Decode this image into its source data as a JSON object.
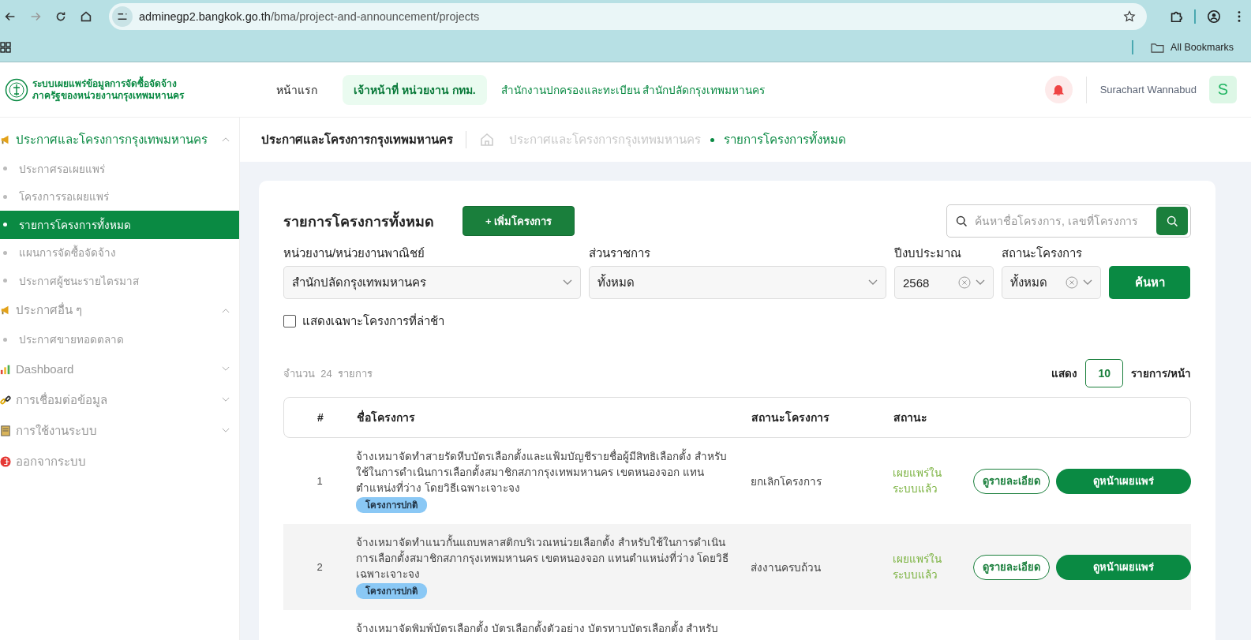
{
  "browser": {
    "url_host": "adminegp2.bangkok.go.th",
    "url_path": "/bma/project-and-announcement/projects",
    "bookmarks_label": "All Bookmarks"
  },
  "header": {
    "logo_lines": [
      "ระบบเผยแพร่ข้อมูลการจัดซื้อจัดจ้าง",
      "ภาครัฐของหน่วยงานกรุงเทพมหานคร"
    ],
    "nav": [
      {
        "label": "หน้าแรก",
        "selected": false
      },
      {
        "label": "เจ้าหน้าที่ หน่วยงาน กทม.",
        "selected": true
      }
    ],
    "agency": "สำนักงานปกครองและทะเบียน สำนักปลัดกรุงเทพมหานคร",
    "user_name": "Surachart Wannabud",
    "avatar_initial": "S"
  },
  "sidebar": {
    "groups": [
      {
        "label": "ประกาศและโครงการกรุงเทพมหานคร",
        "kind": "section",
        "active": true,
        "expanded": true,
        "items": [
          {
            "label": "ประกาศรอเผยแพร่",
            "selected": false
          },
          {
            "label": "โครงการรอเผยแพร่",
            "selected": false
          },
          {
            "label": "รายการโครงการทั้งหมด",
            "selected": true
          },
          {
            "label": "แผนการจัดซื้อจัดจ้าง",
            "selected": false
          },
          {
            "label": "ประกาศผู้ชนะรายไตรมาส",
            "selected": false
          }
        ]
      },
      {
        "label": "ประกาศอื่น ๆ",
        "kind": "section",
        "active": false,
        "expanded": true,
        "items": [
          {
            "label": "ประกาศขายทอดตลาด",
            "selected": false
          }
        ]
      },
      {
        "label": "Dashboard",
        "kind": "section",
        "active": false,
        "expanded": false
      },
      {
        "label": "การเชื่อมต่อข้อมูล",
        "kind": "section",
        "active": false,
        "expanded": false
      },
      {
        "label": "การใช้งานระบบ",
        "kind": "section",
        "active": false,
        "expanded": false
      },
      {
        "label": "ออกจากระบบ",
        "kind": "link",
        "active": false
      }
    ]
  },
  "breadcrumb": {
    "title": "ประกาศและโครงการกรุงเทพมหานคร",
    "crumbs": [
      {
        "label": "ประกาศและโครงการกรุงเทพมหานคร",
        "selected": false
      },
      {
        "label": "รายการโครงการทั้งหมด",
        "selected": true
      }
    ]
  },
  "panel": {
    "title": "รายการโครงการทั้งหมด",
    "add_button": "+ เพิ่มโครงการ",
    "search": {
      "placeholder": "ค้นหาชื่อโครงการ, เลขที่โครงการ"
    },
    "filters": [
      {
        "label": "หน่วยงาน/หน่วยงานพาณิชย์",
        "value": "สำนักปลัดกรุงเทพมหานคร",
        "clearable": false
      },
      {
        "label": "ส่วนราชการ",
        "value": "ทั้งหมด",
        "clearable": false
      },
      {
        "label": "ปีงบประมาณ",
        "value": "2568",
        "clearable": true
      },
      {
        "label": "สถานะโครงการ",
        "value": "ทั้งหมด",
        "clearable": true
      }
    ],
    "search_button": "ค้นหา",
    "late_only": {
      "label": "แสดงเฉพาะโครงการที่ล่าช้า",
      "checked": false
    },
    "count": {
      "prefix": "จำนวน",
      "number": "24",
      "suffix": "รายการ"
    },
    "page_size": {
      "prefix": "แสดง",
      "value": "10",
      "suffix": "รายการ/หน้า"
    }
  },
  "table": {
    "columns": [
      "#",
      "ชื่อโครงการ",
      "สถานะโครงการ",
      "สถานะ"
    ],
    "rows": [
      {
        "number": "1",
        "name": "จ้างเหมาจัดทำสายรัดหีบบัตรเลือกตั้งและแฟ้มบัญชีรายชื่อผู้มีสิทธิเลือกตั้ง สำหรับใช้ในการดำเนินการเลือกตั้งสมาชิกสภากรุงเทพมหานคร เขตหนองจอก แทนตำแหน่งที่ว่าง โดยวิธีเฉพาะเจาะจง",
        "tag": "โครงการปกติ",
        "project_status": "ยกเลิกโครงการ",
        "status": "เผยแพร่ในระบบแล้ว",
        "detail_button": "ดูรายละเอียด",
        "publish_button": "ดูหน้าเผยแพร่"
      },
      {
        "number": "2",
        "name": "จ้างเหมาจัดทำแนวกั้นแถบพลาสติกบริเวณหน่วยเลือกตั้ง สำหรับใช้ในการดำเนินการเลือกตั้งสมาชิกสภากรุงเทพมหานคร เขตหนองจอก แทนตำแหน่งที่ว่าง โดยวิธีเฉพาะเจาะจง",
        "tag": "โครงการปกติ",
        "project_status": "ส่งงานครบถ้วน",
        "status": "เผยแพร่ในระบบแล้ว",
        "detail_button": "ดูรายละเอียด",
        "publish_button": "ดูหน้าเผยแพร่"
      },
      {
        "name": "จ้างเหมาจัดพิมพ์บัตรเลือกตั้ง บัตรเลือกตั้งตัวอย่าง บัตรทาบบัตรเลือกตั้ง สำหรับ"
      }
    ]
  }
}
